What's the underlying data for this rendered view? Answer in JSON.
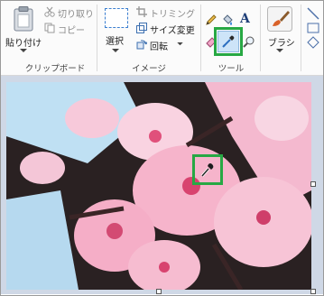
{
  "clipboard": {
    "paste_label": "貼り付け",
    "cut_label": "切り取り",
    "copy_label": "コピー",
    "group_label": "クリップボード"
  },
  "image": {
    "select_label": "選択",
    "crop_label": "トリミング",
    "resize_label": "サイズ変更",
    "rotate_label": "回転",
    "group_label": "イメージ"
  },
  "tools": {
    "text_glyph": "A",
    "group_label": "ツール"
  },
  "brushes": {
    "label": "ブラシ"
  },
  "colors": {
    "highlight": "#27a844",
    "selection_box": "#3c7fd0"
  }
}
